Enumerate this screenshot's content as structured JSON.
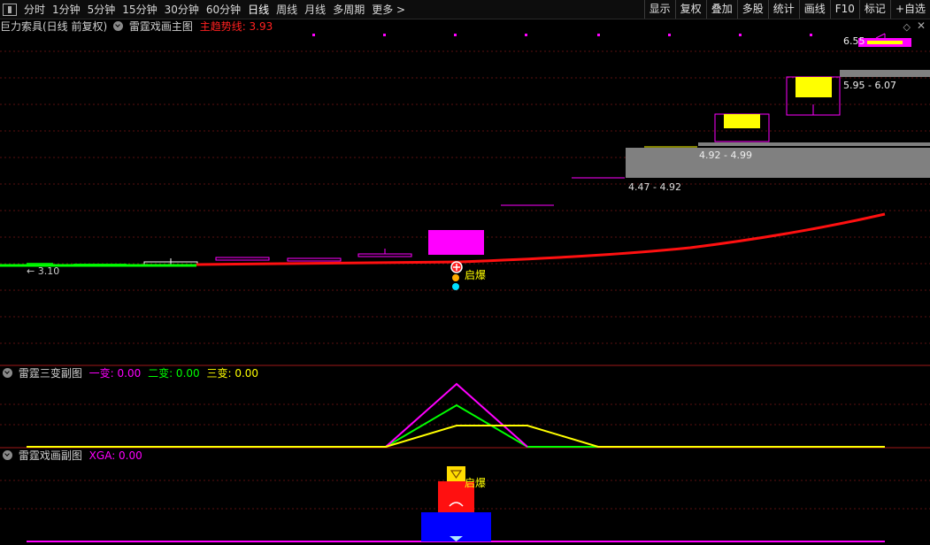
{
  "toolbar": {
    "periods": [
      "分时",
      "1分钟",
      "5分钟",
      "15分钟",
      "30分钟",
      "60分钟",
      "日线",
      "周线",
      "月线",
      "多周期",
      "更多 >"
    ],
    "active_period": "日线",
    "right_buttons": [
      "显示",
      "复权",
      "叠加",
      "多股",
      "统计",
      "画线",
      "F10",
      "标记",
      "+自选"
    ]
  },
  "main_panel": {
    "title_prefix": "巨力索具(日线 前复权)",
    "indicator": "雷霆戏画主图",
    "trend_label": "主趋势线: 3.93",
    "colors": {
      "trend": "#ff2020",
      "magenta": "#ff00ff",
      "yellow": "#ffff00",
      "gray": "#808080"
    }
  },
  "main_labels": {
    "left_price": "← 3.10",
    "signal": "启爆",
    "zone1": "4.47 - 4.92",
    "zone2": "4.92 - 4.99",
    "zone3": "5.95 - 6.07",
    "top_price": "6.55"
  },
  "sub1": {
    "title": "雷霆三变副图",
    "v1": "一变: 0.00",
    "v2": "二变: 0.00",
    "v3": "三变: 0.00",
    "colors": {
      "v1": "#ff00ff",
      "v2": "#00ff00",
      "v3": "#ffff00"
    }
  },
  "sub2": {
    "title": "雷霆戏画副图",
    "value": "XGA: 0.00",
    "signal": "启爆",
    "colors": {
      "value": "#ff00ff"
    }
  }
}
